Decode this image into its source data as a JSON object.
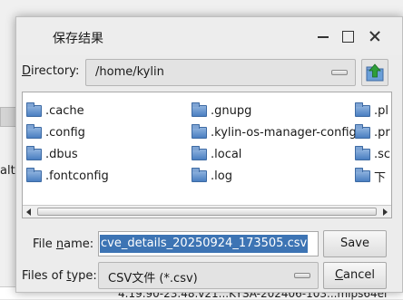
{
  "background": {
    "side_text": "alt",
    "status_text": "4.19.90-23.48.v21...KYSA-202406-103...mips64el"
  },
  "dialog": {
    "title": "保存结果",
    "directory_label_mnemonic": "D",
    "directory_label_rest": "irectory:",
    "directory_value": "/home/kylin",
    "files": [
      {
        "name": ".cache",
        "col": 0,
        "row": 0
      },
      {
        "name": ".config",
        "col": 0,
        "row": 1
      },
      {
        "name": ".dbus",
        "col": 0,
        "row": 2
      },
      {
        "name": ".fontconfig",
        "col": 0,
        "row": 3
      },
      {
        "name": ".gnupg",
        "col": 1,
        "row": 0
      },
      {
        "name": ".kylin-os-manager-config",
        "col": 1,
        "row": 1
      },
      {
        "name": ".local",
        "col": 1,
        "row": 2
      },
      {
        "name": ".log",
        "col": 1,
        "row": 3
      },
      {
        "name": ".pl",
        "col": 2,
        "row": 0
      },
      {
        "name": ".pr",
        "col": 2,
        "row": 1
      },
      {
        "name": ".sc",
        "col": 2,
        "row": 2
      },
      {
        "name": "下",
        "col": 2,
        "row": 3
      }
    ],
    "filename_label_prefix": "File ",
    "filename_label_mnemonic": "n",
    "filename_label_rest": "ame:",
    "filename_value": "cve_details_20250924_173505.csv",
    "save_label": "Save",
    "filetype_label_prefix": "Files of ",
    "filetype_label_mnemonic": "t",
    "filetype_label_rest": "ype:",
    "filetype_value": "CSV文件 (*.csv)",
    "cancel_label_mnemonic": "C",
    "cancel_label_rest": "ancel"
  },
  "icons": {
    "folder": "folder-icon",
    "up": "up-folder-icon"
  },
  "colors": {
    "selection": "#3d74b4",
    "folder": "#4a7fc1",
    "up_arrow": "#2e9e3a"
  }
}
